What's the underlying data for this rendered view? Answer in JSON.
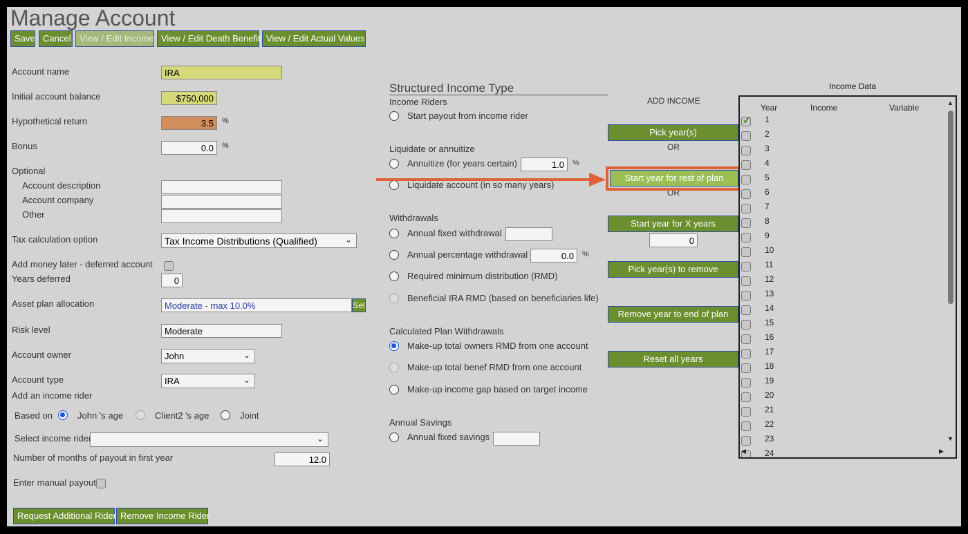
{
  "page": {
    "title": "Manage Account"
  },
  "toolbar": {
    "save": "Save",
    "cancel": "Cancel",
    "income": "View / Edit Income",
    "death": "View / Edit Death Benefit",
    "actual": "View / Edit Actual Values"
  },
  "form": {
    "account_name_label": "Account name",
    "account_name": "IRA",
    "initial_balance_label": "Initial account balance",
    "initial_balance": "$750,000",
    "return_label": "Hypothetical return",
    "return_value": "3.5",
    "bonus_label": "Bonus",
    "bonus_value": "0.0",
    "percent": "%",
    "optional_label": "Optional",
    "desc_label": "Account description",
    "company_label": "Account company",
    "other_label": "Other",
    "tax_label": "Tax calculation option",
    "tax_value": "Tax Income Distributions (Qualified)",
    "add_money_label": "Add money later - deferred account",
    "years_deferred_label": "Years deferred",
    "years_deferred": "0",
    "asset_label": "Asset plan allocation",
    "asset_value": "Moderate - max 10.0%",
    "asset_sel": "Sel",
    "risk_label": "Risk level",
    "risk_value": "Moderate",
    "owner_label": "Account owner",
    "owner_value": "John",
    "type_label": "Account type",
    "type_value": "IRA"
  },
  "rider": {
    "heading": "Add an income rider",
    "based_on": "Based on",
    "opt1": "John 's age",
    "opt2": "Client2 's age",
    "opt3": "Joint",
    "select_label": "Select income rider",
    "months_label": "Number of months of payout in first year",
    "months_value": "12.0",
    "manual_label": "Enter manual payout",
    "request": "Request Additional Rider",
    "remove": "Remove Income Rider"
  },
  "structured": {
    "title": "Structured Income Type",
    "riders_head": "Income Riders",
    "start_payout": "Start payout from income rider",
    "liq_head": "Liquidate or annuitize",
    "annuitize": "Annuitize (for years certain)",
    "annuitize_value": "1.0",
    "liquidate": "Liquidate account (in so many years)",
    "wd_head": "Withdrawals",
    "fixed_wd": "Annual fixed withdrawal",
    "pct_wd": "Annual percentage withdrawal",
    "pct_value": "0.0",
    "rmd": "Required minimum distribution (RMD)",
    "benef": "Beneficial IRA RMD (based on beneficiaries life)",
    "calc_head": "Calculated Plan Withdrawals",
    "makeup_owner": "Make-up total owners RMD from one account",
    "makeup_benef": "Make-up total benef RMD from one account",
    "makeup_gap": "Make-up income gap based on target income",
    "savings_head": "Annual Savings",
    "fixed_savings": "Annual fixed savings"
  },
  "add_income": {
    "title": "ADD INCOME",
    "pick": "Pick year(s)",
    "or1": "OR",
    "start_rest": "Start year for rest of plan",
    "or2": "OR",
    "start_x": "Start year for X years",
    "x_value": "0",
    "pick_remove": "Pick year(s) to remove",
    "remove_end": "Remove year to end of plan",
    "reset": "Reset all years"
  },
  "income_data": {
    "title": "Income Data",
    "col_year": "Year",
    "col_income": "Income",
    "col_variable": "Variable",
    "years": [
      "1",
      "2",
      "3",
      "4",
      "5",
      "6",
      "7",
      "8",
      "9",
      "10",
      "11",
      "12",
      "13",
      "14",
      "15",
      "16",
      "17",
      "18",
      "19",
      "20",
      "21",
      "22",
      "23",
      "24"
    ],
    "checked": [
      true,
      false,
      false,
      false,
      false,
      false,
      false,
      false,
      false,
      false,
      false,
      false,
      false,
      false,
      false,
      false,
      false,
      false,
      false,
      false,
      false,
      false,
      false,
      false
    ]
  },
  "colors": {
    "button": "#6b8e2f",
    "highlight": "#e0603a",
    "radio_on": "#1a55d6"
  }
}
